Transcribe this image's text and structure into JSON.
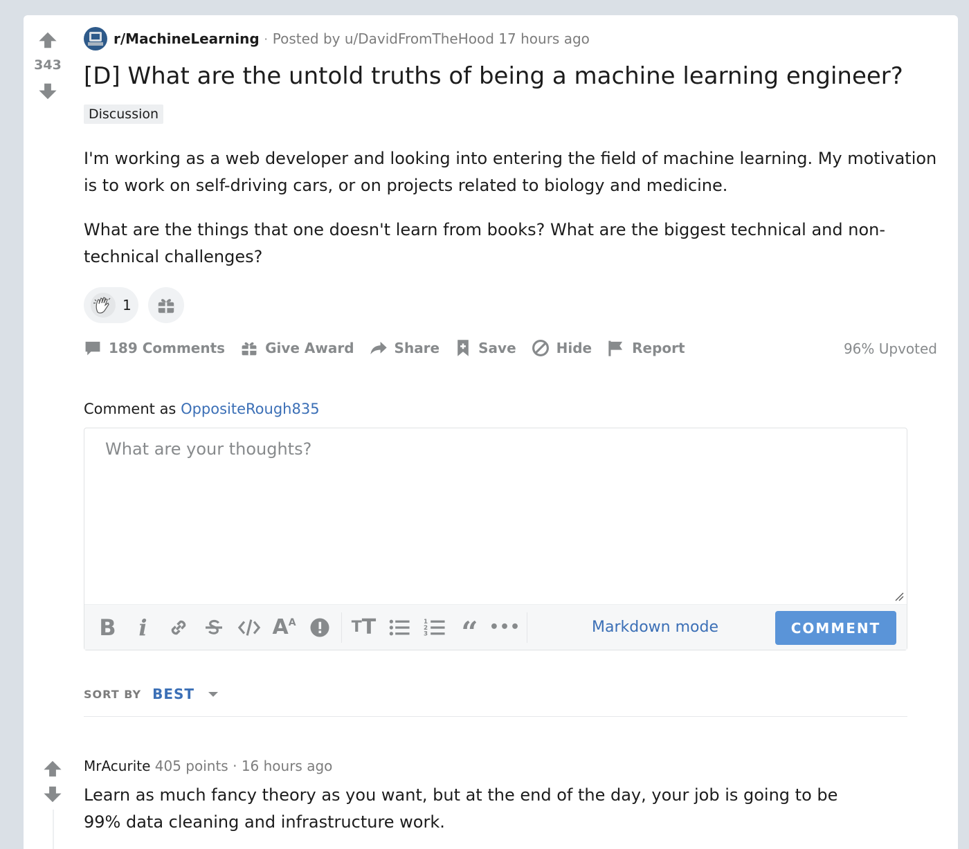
{
  "post": {
    "score": "343",
    "subreddit": "r/MachineLearning",
    "posted_by": "Posted by u/DavidFromTheHood 17 hours ago",
    "title": "[D] What are the untold truths of being a machine learning engineer?",
    "flair": "Discussion",
    "body": [
      "I'm working as a web developer and looking into entering the field of machine learning. My motivation is to work on self-driving cars, or on projects related to biology and medicine.",
      "What are the things that one doesn't learn from books? What are the biggest technical and non-technical challenges?"
    ],
    "award_count": "1",
    "actions": {
      "comments": "189 Comments",
      "give_award": "Give Award",
      "share": "Share",
      "save": "Save",
      "hide": "Hide",
      "report": "Report"
    },
    "upvoted": "96% Upvoted"
  },
  "composer": {
    "comment_as_label": "Comment as",
    "username": "OppositeRough835",
    "placeholder": "What are your thoughts?",
    "markdown_mode": "Markdown mode",
    "submit": "COMMENT"
  },
  "sort": {
    "label": "SORT BY",
    "value": "BEST"
  },
  "comments": [
    {
      "author": "MrAcurite",
      "points": "405 points",
      "time": "16 hours ago",
      "body": "Learn as much fancy theory as you want, but at the end of the day, your job is going to be 99% data cleaning and infrastructure work."
    }
  ],
  "icons": [
    "upvote-icon",
    "downvote-icon",
    "comment-icon",
    "gift-icon",
    "share-icon",
    "save-icon",
    "hide-icon",
    "report-icon",
    "clap-award-icon",
    "bold-icon",
    "italic-icon",
    "link-icon",
    "strikethrough-icon",
    "code-icon",
    "superscript-icon",
    "spoiler-icon",
    "heading-icon",
    "bullet-list-icon",
    "numbered-list-icon",
    "quote-icon",
    "more-icon",
    "caret-down-icon"
  ],
  "colors": {
    "background": "#dae0e6",
    "accent": "#3b6fb6",
    "button": "#5a94d8",
    "muted": "#878a8c"
  }
}
